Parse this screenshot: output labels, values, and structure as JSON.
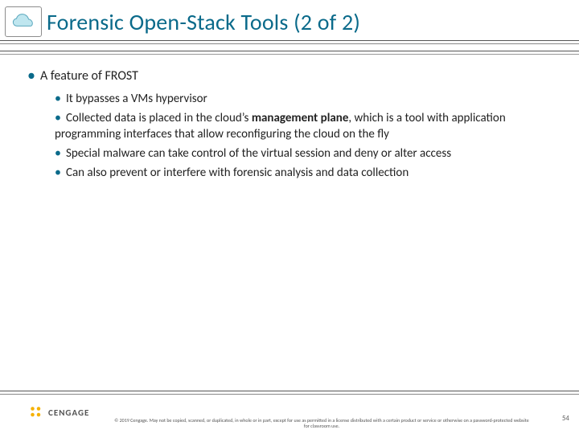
{
  "header": {
    "title": "Forensic Open-Stack Tools (2 of 2)",
    "icon": "cloud-icon"
  },
  "body": {
    "lvl1_bullet": "•",
    "lvl2_bullet": "•",
    "feature_line": "A feature of FROST",
    "items": {
      "b1": "It bypasses a VMs hypervisor",
      "b2_pre": "Collected data is placed in the cloud’s ",
      "b2_bold": "management plane",
      "b2_post": ", which is a tool with application programming interfaces that allow reconfiguring the cloud on the fly",
      "b3": "Special malware can take control of the virtual session and deny or alter access",
      "b4": "Can also prevent or interfere with forensic analysis and data collection"
    }
  },
  "footer": {
    "brand": "CENGAGE",
    "copyright": "© 2019 Cengage. May not be copied, scanned, or duplicated, in whole or in part, except for use as permitted in a license distributed with a certain product or service or otherwise on a password-protected website for classroom use.",
    "page": "54"
  }
}
